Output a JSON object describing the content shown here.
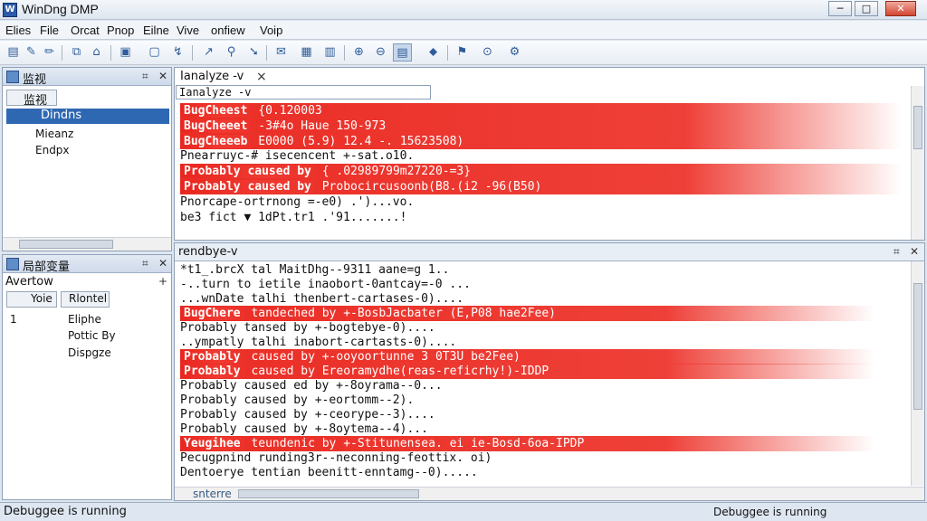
{
  "titlebar": {
    "title": "WinDng DMP",
    "min": "─",
    "max": "□",
    "close": "✕"
  },
  "menu": [
    "Elies",
    "File",
    "Orcat",
    "Pnop",
    "Eilne",
    "Vive",
    "onfiew",
    "Voip"
  ],
  "left_top": {
    "title": "监视",
    "sub": "监视",
    "items": [
      "Dindns",
      "Mieanz",
      "Endpx"
    ]
  },
  "left_bottom": {
    "title": "局部变量",
    "filter": "Avertow",
    "tabs": [
      "Yoie",
      "Rlontel"
    ],
    "row_num": "1",
    "items": [
      "Eliphe",
      "Pottic By",
      "Dispgze"
    ]
  },
  "cmd": {
    "title": "Ianalyze -v",
    "input": "Ianalyze -v",
    "close": "×"
  },
  "cmd_lines": [
    {
      "hl": "BugCheest",
      "rest": "{0.120003"
    },
    {
      "hl": "BugCheeet",
      "rest": "-3#4o  Haue 150-973"
    },
    {
      "hl": "BugCheeeb",
      "rest": "E0000 (5.9) 12.4 -. 15623508)"
    },
    {
      "hl": "",
      "rest": "Pnearruyc-# isecencent +-sat.o10."
    },
    {
      "hl": "Probably caused by",
      "rest": "{ .02989799m27220-=3}"
    },
    {
      "hl": "Probably caused by",
      "rest": "Probocircusoonb(B8.(i2 -96(B50)"
    },
    {
      "hl": "",
      "rest": "Pnorcape-ortrnong =-e0) .')...vo."
    },
    {
      "hl": "",
      "rest": "  be3 fict ▼ 1dPt.tr1 .'91.......!"
    }
  ],
  "output": {
    "title": "rendbye-v",
    "tab": "snterre"
  },
  "out_lines": [
    {
      "hl": "",
      "rest": "*t1_.brcX  tal MaitDhg--9311 aane=g 1.."
    },
    {
      "hl": "",
      "rest": " -..turn to ietile inaobort-0antcay=-0 ..."
    },
    {
      "hl": "",
      "rest": " ...wnDate talhi thenbert-cartases-0)...."
    },
    {
      "hl": "BugChere",
      "rest": " tandeched by +-BosbJacbater (E,P08 hae2Fee)"
    },
    {
      "hl": "",
      "rest": " Probably tansed by +-bogtebye-0)...."
    },
    {
      "hl": "",
      "rest": " ..ympatly talhi inabort-cartasts-0)...."
    },
    {
      "hl": "Probably",
      "rest": " caused by +-ooyoortunne 3 0T3U be2Fee)"
    },
    {
      "hl": "Probably",
      "rest": " caused by Ereoramydhe(reas-reficrhy!)-IDDP"
    },
    {
      "hl": "",
      "rest": " Probably caused ed by +-8oyrama--0..."
    },
    {
      "hl": "",
      "rest": " Probably caused by +-eortomm--2)."
    },
    {
      "hl": "",
      "rest": " Probably caused by +-ceorype--3)...."
    },
    {
      "hl": "",
      "rest": " Probably caused by +-8oytema--4)..."
    },
    {
      "hl": "Yeugihee",
      "rest": " teundenic by +-Stitunensea. ei ie-Bosd-6oa-IPDP"
    },
    {
      "hl": "",
      "rest": " Pecugpnind  runding3r--neconning-feottix. oi)"
    },
    {
      "hl": "",
      "rest": " Dentoerye tentian beenitt-enntamg--0)....."
    }
  ],
  "status": {
    "left": "Debuggee is running",
    "right": "Debuggee is running"
  }
}
